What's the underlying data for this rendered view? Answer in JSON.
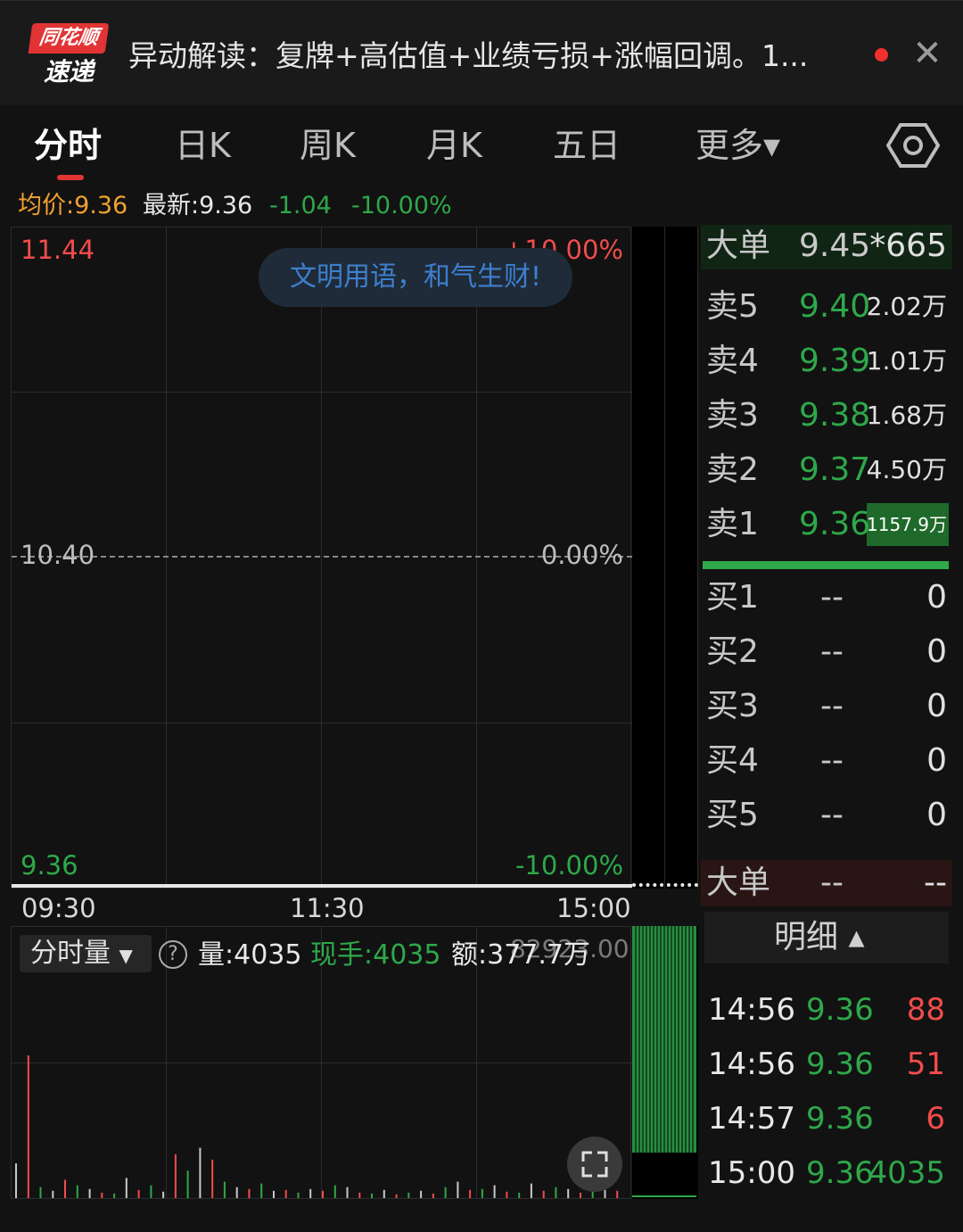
{
  "header": {
    "logo_top": "同花顺",
    "logo_bottom": "速递",
    "news_title": "异动解读：复牌+高估值+业绩亏损+涨幅回调。1..."
  },
  "tabs": [
    {
      "label": "分时"
    },
    {
      "label": "日K"
    },
    {
      "label": "周K"
    },
    {
      "label": "月K"
    },
    {
      "label": "五日"
    },
    {
      "label": "更多▾"
    }
  ],
  "quote": {
    "avg_label": "均价:9.36",
    "latest_label": "最新:9.36",
    "change": "-1.04",
    "change_pct": "-10.00%"
  },
  "price_chart": {
    "top_price": "11.44",
    "top_pct": "+10.00%",
    "mid_price": "10.40",
    "mid_pct": "0.00%",
    "bottom_price": "9.36",
    "bottom_pct": "-10.00%",
    "badge": "文明用语，和气生财!",
    "times": [
      "09:30",
      "11:30",
      "15:00"
    ]
  },
  "volume_chart": {
    "selector": "分时量",
    "volume": "量:4035",
    "current_hand": "现手:4035",
    "amount": "额:377.7万",
    "overlay_value": "82923.00"
  },
  "chart_data": {
    "type": "bar",
    "title": "",
    "series": [
      {
        "name": "",
        "values": [
          38,
          156,
          12,
          8,
          20,
          14,
          10,
          6,
          5,
          22,
          9,
          14,
          7,
          48,
          30,
          55,
          42,
          18,
          12,
          10,
          16,
          8,
          9,
          6,
          10,
          8,
          14,
          12,
          6,
          5,
          9,
          4,
          6,
          8,
          5,
          12,
          18,
          9,
          10,
          14,
          7,
          6,
          16,
          8,
          12,
          10,
          6,
          14,
          9,
          8
        ]
      }
    ]
  },
  "orderbook": {
    "big_sell": {
      "label": "大单",
      "price": "9.45",
      "vol": "*665"
    },
    "sells": [
      {
        "label": "卖5",
        "price": "9.40",
        "vol": "2.02万"
      },
      {
        "label": "卖4",
        "price": "9.39",
        "vol": "1.01万"
      },
      {
        "label": "卖3",
        "price": "9.38",
        "vol": "1.68万"
      },
      {
        "label": "卖2",
        "price": "9.37",
        "vol": "4.50万"
      },
      {
        "label": "卖1",
        "price": "9.36",
        "vol": "1157.9万"
      }
    ],
    "buys": [
      {
        "label": "买1",
        "price": "--",
        "vol": "0"
      },
      {
        "label": "买2",
        "price": "--",
        "vol": "0"
      },
      {
        "label": "买3",
        "price": "--",
        "vol": "0"
      },
      {
        "label": "买4",
        "price": "--",
        "vol": "0"
      },
      {
        "label": "买5",
        "price": "--",
        "vol": "0"
      }
    ],
    "big_buy": {
      "label": "大单",
      "price": "--",
      "vol": "--"
    },
    "detail_label": "明细 ▴",
    "trades": [
      {
        "time": "14:56",
        "price": "9.36",
        "vol": "88"
      },
      {
        "time": "14:56",
        "price": "9.36",
        "vol": "51"
      },
      {
        "time": "14:57",
        "price": "9.36",
        "vol": "6"
      },
      {
        "time": "15:00",
        "price": "9.36",
        "vol": "4035"
      }
    ]
  },
  "colors": {
    "up": "#f24c4c",
    "down": "#2ea84a",
    "brand": "#e23434"
  }
}
